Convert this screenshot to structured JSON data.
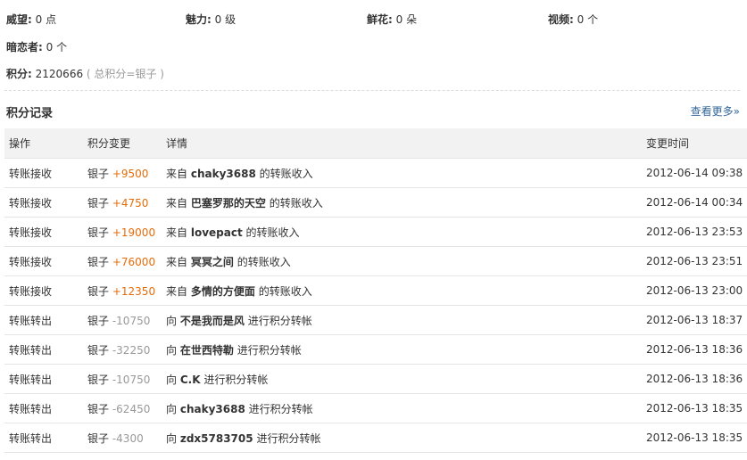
{
  "stats": {
    "weili": {
      "label": "威望:",
      "value": "0 点"
    },
    "meili": {
      "label": "魅力:",
      "value": "0 级"
    },
    "xianhua": {
      "label": "鲜花:",
      "value": "0 朵"
    },
    "shipin": {
      "label": "视频:",
      "value": "0 个"
    },
    "anlian": {
      "label": "暗恋者:",
      "value": "0 个"
    },
    "jifen": {
      "label": "积分:",
      "value": "2120666",
      "note": "( 总积分=银子 )"
    }
  },
  "section": {
    "title": "积分记录",
    "more_label": "查看更多»"
  },
  "table": {
    "headers": {
      "op": "操作",
      "change": "积分变更",
      "detail": "详情",
      "time": "变更时间"
    },
    "rows": [
      {
        "op": "转账接收",
        "currency": "银子",
        "amount": "+9500",
        "prefix": "来自",
        "name": "chaky3688",
        "suffix": "的转账收入",
        "time": "2012-06-14 09:38"
      },
      {
        "op": "转账接收",
        "currency": "银子",
        "amount": "+4750",
        "prefix": "来自",
        "name": "巴塞罗那的天空",
        "suffix": "的转账收入",
        "time": "2012-06-14 00:34"
      },
      {
        "op": "转账接收",
        "currency": "银子",
        "amount": "+19000",
        "prefix": "来自",
        "name": "lovepact",
        "suffix": "的转账收入",
        "time": "2012-06-13 23:53"
      },
      {
        "op": "转账接收",
        "currency": "银子",
        "amount": "+76000",
        "prefix": "来自",
        "name": "冥冥之间",
        "suffix": "的转账收入",
        "time": "2012-06-13 23:51"
      },
      {
        "op": "转账接收",
        "currency": "银子",
        "amount": "+12350",
        "prefix": "来自",
        "name": "多情的方便面",
        "suffix": "的转账收入",
        "time": "2012-06-13 23:00"
      },
      {
        "op": "转账转出",
        "currency": "银子",
        "amount": "-10750",
        "prefix": "向",
        "name": "不是我而是风",
        "suffix": "进行积分转帐",
        "time": "2012-06-13 18:37"
      },
      {
        "op": "转账转出",
        "currency": "银子",
        "amount": "-32250",
        "prefix": "向",
        "name": "在世西特勒",
        "suffix": "进行积分转帐",
        "time": "2012-06-13 18:36"
      },
      {
        "op": "转账转出",
        "currency": "银子",
        "amount": "-10750",
        "prefix": "向",
        "name": "C.K",
        "suffix": "进行积分转帐",
        "time": "2012-06-13 18:36"
      },
      {
        "op": "转账转出",
        "currency": "银子",
        "amount": "-62450",
        "prefix": "向",
        "name": "chaky3688",
        "suffix": "进行积分转帐",
        "time": "2012-06-13 18:35"
      },
      {
        "op": "转账转出",
        "currency": "银子",
        "amount": "-4300",
        "prefix": "向",
        "name": "zdx5783705",
        "suffix": "进行积分转帐",
        "time": "2012-06-13 18:35"
      }
    ]
  },
  "colors": {
    "income": "#e46c0a",
    "expense": "#999999",
    "link": "#336699",
    "header_bg": "#f2f2f2"
  }
}
